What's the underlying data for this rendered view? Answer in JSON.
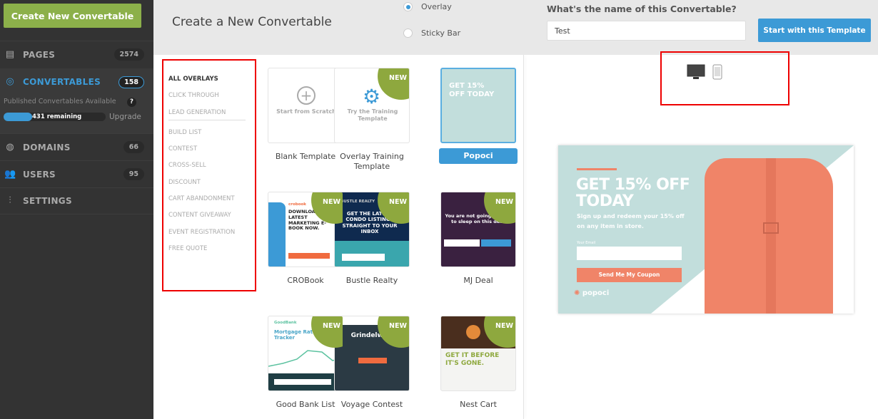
{
  "sidebar": {
    "create_button": "Create New Convertable",
    "items": [
      {
        "label": "PAGES",
        "count": "2574",
        "icon": "pages-icon"
      },
      {
        "label": "CONVERTABLES",
        "count": "158",
        "icon": "target-icon"
      },
      {
        "label": "DOMAINS",
        "count": "66",
        "icon": "globe-icon"
      },
      {
        "label": "USERS",
        "count": "95",
        "icon": "users-icon"
      },
      {
        "label": "SETTINGS",
        "icon": "sliders-icon"
      }
    ],
    "published_label": "Published Convertables Available",
    "help": "?",
    "remaining": "431 remaining",
    "remaining_progress_pct": 28,
    "upgrade": "Upgrade"
  },
  "header": {
    "title": "Create a New Convertable",
    "types": [
      {
        "label": "Overlay",
        "selected": true
      },
      {
        "label": "Sticky Bar",
        "selected": false
      }
    ],
    "name_question": "What's the name of this Convertable?",
    "name_value": "Test",
    "start_button": "Start with this Template"
  },
  "categories": [
    "ALL OVERLAYS",
    "CLICK THROUGH",
    "LEAD GENERATION",
    "BUILD LIST",
    "CONTEST",
    "CROSS-SELL",
    "DISCOUNT",
    "CART ABANDONMENT",
    "CONTENT GIVEAWAY",
    "EVENT REGISTRATION",
    "FREE QUOTE"
  ],
  "new_badge": "NEW",
  "templates": [
    {
      "name": "Blank Template",
      "thumb": "Start from Scratch"
    },
    {
      "name": "Overlay Training Template",
      "thumb": "Try the Training Template"
    },
    {
      "name": "Popoci",
      "thumb": "GET 15% OFF TODAY",
      "selected": true
    },
    {
      "name": "CROBook",
      "thumb": "DOWNLOAD THE LATEST MARKETING E-BOOK NOW.",
      "brand": "crobook"
    },
    {
      "name": "Bustle Realty",
      "thumb": "GET THE LATEST CONDO LISTINGS STRAIGHT TO YOUR INBOX",
      "brand": "BUSTLE REALTY"
    },
    {
      "name": "MJ Deal",
      "thumb": "You are not going to want to sleep on this deal!"
    },
    {
      "name": "Good Bank List",
      "thumb": "Mortgage Rates Tracker",
      "brand": "GoodBank"
    },
    {
      "name": "Voyage Contest",
      "thumb": "Grindelwald"
    },
    {
      "name": "Nest Cart",
      "thumb": "GET IT BEFORE IT'S GONE."
    }
  ],
  "preview": {
    "headline": "GET 15% OFF TODAY",
    "body": "Sign up and redeem your 15% off on any item in store.",
    "email_label": "Your Email",
    "button": "Send Me My Coupon",
    "brand": "popoci"
  },
  "colors": {
    "accent": "#3c9ad6",
    "create": "#8cb04a",
    "new_badge": "#8ea83e",
    "coral": "#f08468",
    "mint": "#c2dedc"
  }
}
